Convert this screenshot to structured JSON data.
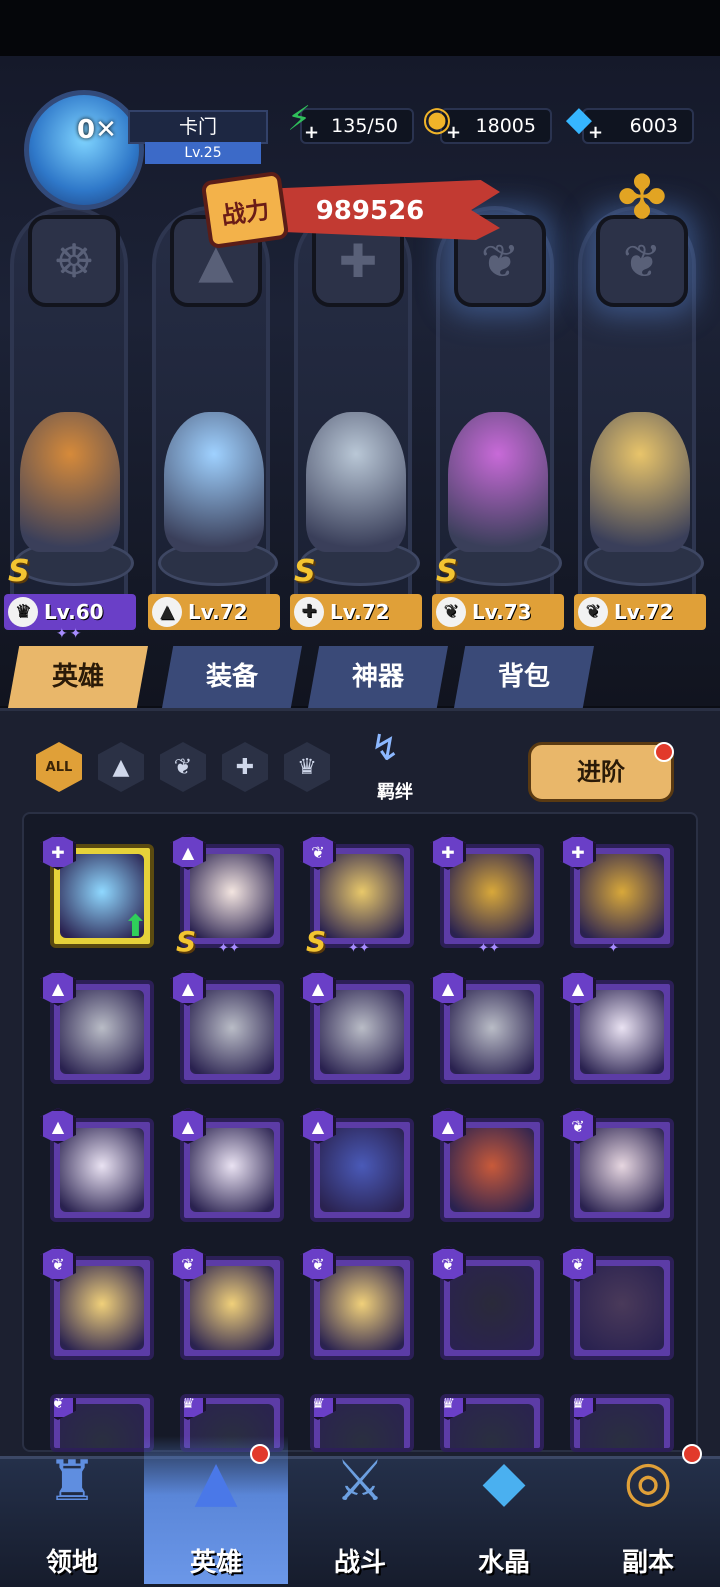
{
  "player": {
    "vip": "0",
    "name": "卡门",
    "level": "Lv.25"
  },
  "resources": [
    {
      "name": "stamina",
      "icon": "lightning-icon",
      "value": "135/50",
      "color": "#2fbf5a"
    },
    {
      "name": "gold",
      "icon": "gold-coin-icon",
      "value": "18005",
      "color": "#f0b429"
    },
    {
      "name": "diamond",
      "icon": "diamond-icon",
      "value": "6003",
      "color": "#36b6ff"
    }
  ],
  "power": {
    "label": "战力",
    "value": "989526"
  },
  "team": [
    {
      "name": "hero-dragon-druid",
      "level": "Lv.60",
      "class": "beast",
      "rank": "S",
      "stars": "✦✦",
      "bar_color": "#6a3fc7",
      "color": "#d68a3a"
    },
    {
      "name": "hero-ice-sorceress",
      "level": "Lv.72",
      "class": "mage",
      "rank": "",
      "stars": "",
      "bar_color": "#e0a038",
      "color": "#9fd1ff"
    },
    {
      "name": "hero-mech-spider",
      "level": "Lv.72",
      "class": "tech",
      "rank": "S",
      "stars": "",
      "bar_color": "#e0a038",
      "color": "#b9c7d6"
    },
    {
      "name": "hero-succubus",
      "level": "Lv.73",
      "class": "wing",
      "rank": "S",
      "stars": "",
      "bar_color": "#e0a038",
      "color": "#c86ad8"
    },
    {
      "name": "hero-golden-angel",
      "level": "Lv.72",
      "class": "wing",
      "rank": "",
      "stars": "",
      "bar_color": "#e0a038",
      "color": "#e8c46a"
    }
  ],
  "tabs": [
    "英雄",
    "装备",
    "神器",
    "背包"
  ],
  "filters": {
    "all_label": "ALL",
    "bond_label": "羁绊"
  },
  "advance_label": "进阶",
  "roster": [
    {
      "class": "tech",
      "rank": "",
      "stars": "",
      "color": "#8fd8ff",
      "highlight": true
    },
    {
      "class": "mage",
      "rank": "S",
      "stars": "✦✦",
      "color": "#f3e5e0"
    },
    {
      "class": "wing",
      "rank": "S",
      "stars": "✦✦",
      "color": "#e8c86a"
    },
    {
      "class": "tech",
      "rank": "",
      "stars": "✦✦",
      "color": "#d8a83a"
    },
    {
      "class": "tech",
      "rank": "",
      "stars": "✦",
      "color": "#d8a83a"
    },
    {
      "class": "mage",
      "rank": "",
      "stars": "",
      "color": "#b9bcc6"
    },
    {
      "class": "mage",
      "rank": "",
      "stars": "",
      "color": "#b9bcc6"
    },
    {
      "class": "mage",
      "rank": "",
      "stars": "",
      "color": "#b9bcc6"
    },
    {
      "class": "mage",
      "rank": "",
      "stars": "",
      "color": "#b9bcc6"
    },
    {
      "class": "mage",
      "rank": "",
      "stars": "",
      "color": "#e9e2f2"
    },
    {
      "class": "mage",
      "rank": "",
      "stars": "",
      "color": "#e9e2f2"
    },
    {
      "class": "mage",
      "rank": "",
      "stars": "",
      "color": "#e9e2f2"
    },
    {
      "class": "mage",
      "rank": "",
      "stars": "",
      "color": "#4a5ab8"
    },
    {
      "class": "mage",
      "rank": "",
      "stars": "",
      "color": "#c85a3a"
    },
    {
      "class": "wing",
      "rank": "",
      "stars": "",
      "color": "#e6d6e0"
    },
    {
      "class": "wing",
      "rank": "",
      "stars": "",
      "color": "#f0d07a"
    },
    {
      "class": "wing",
      "rank": "",
      "stars": "",
      "color": "#f0d07a"
    },
    {
      "class": "wing",
      "rank": "",
      "stars": "",
      "color": "#f0d07a"
    },
    {
      "class": "wing",
      "rank": "",
      "stars": "",
      "color": "#2a2a3a"
    },
    {
      "class": "wing",
      "rank": "",
      "stars": "",
      "color": "#4a3a5a"
    },
    {
      "class": "wing",
      "rank": "",
      "stars": "",
      "color": "#2a2f40"
    },
    {
      "class": "beast",
      "rank": "",
      "stars": "",
      "color": "#2a2f40"
    },
    {
      "class": "beast",
      "rank": "",
      "stars": "",
      "color": "#2a2f40"
    },
    {
      "class": "beast",
      "rank": "",
      "stars": "",
      "color": "#2a2f40"
    },
    {
      "class": "beast",
      "rank": "",
      "stars": "",
      "color": "#2a2f40"
    }
  ],
  "nav": [
    {
      "label": "领地",
      "icon": "castle-icon",
      "active": false,
      "dot": false
    },
    {
      "label": "英雄",
      "icon": "wizard-hat-icon",
      "active": true,
      "dot": true
    },
    {
      "label": "战斗",
      "icon": "crossed-swords-icon",
      "active": false,
      "dot": false
    },
    {
      "label": "水晶",
      "icon": "crystal-icon",
      "active": false,
      "dot": false
    },
    {
      "label": "副本",
      "icon": "portal-icon",
      "active": false,
      "dot": true
    }
  ],
  "class_icons": {
    "beast": "♛",
    "mage": "▲",
    "tech": "✚",
    "wing": "❦"
  },
  "accent": "#e9b76a"
}
